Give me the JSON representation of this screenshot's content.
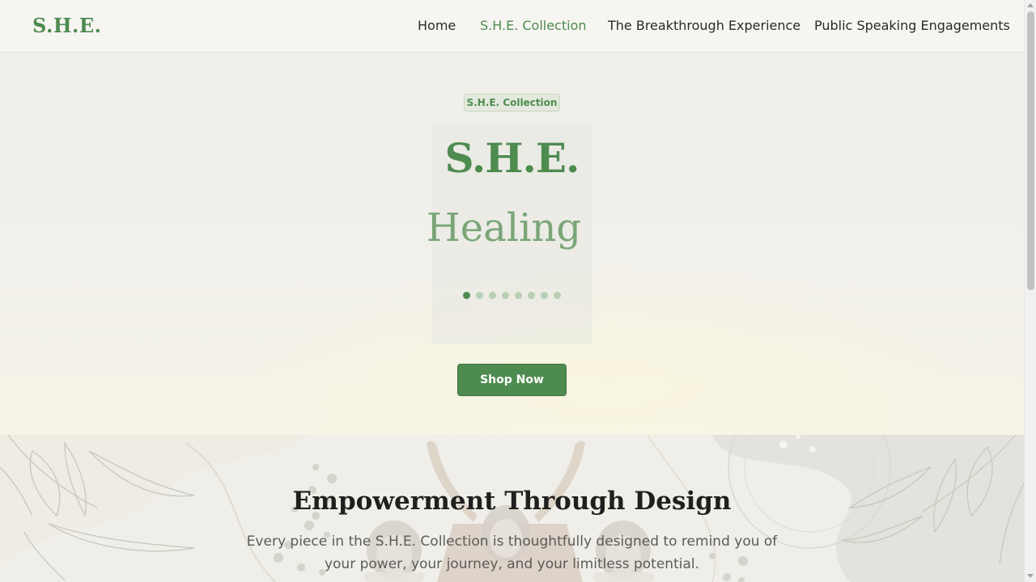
{
  "header": {
    "logo": "S.H.E.",
    "nav": [
      {
        "label": "Home",
        "active": false
      },
      {
        "label": "S.H.E. Collection",
        "active": true
      },
      {
        "label": "The Breakthrough Experience",
        "active": false
      },
      {
        "label": "Public Speaking Engagements",
        "active": false
      }
    ]
  },
  "hero": {
    "badge": "S.H.E. Collection",
    "title": "S.H.E.",
    "word": "Healing",
    "slide_count": 8,
    "active_slide": 1,
    "cta": "Shop Now"
  },
  "section": {
    "title": "Empowerment Through Design",
    "text": "Every piece in the S.H.E. Collection is thoughtfully designed to remind you of your power, your journey, and your limitless potential."
  },
  "colors": {
    "accent": "#4e8b4f",
    "accent_light": "#7aa677",
    "background": "#f3f2ee"
  }
}
